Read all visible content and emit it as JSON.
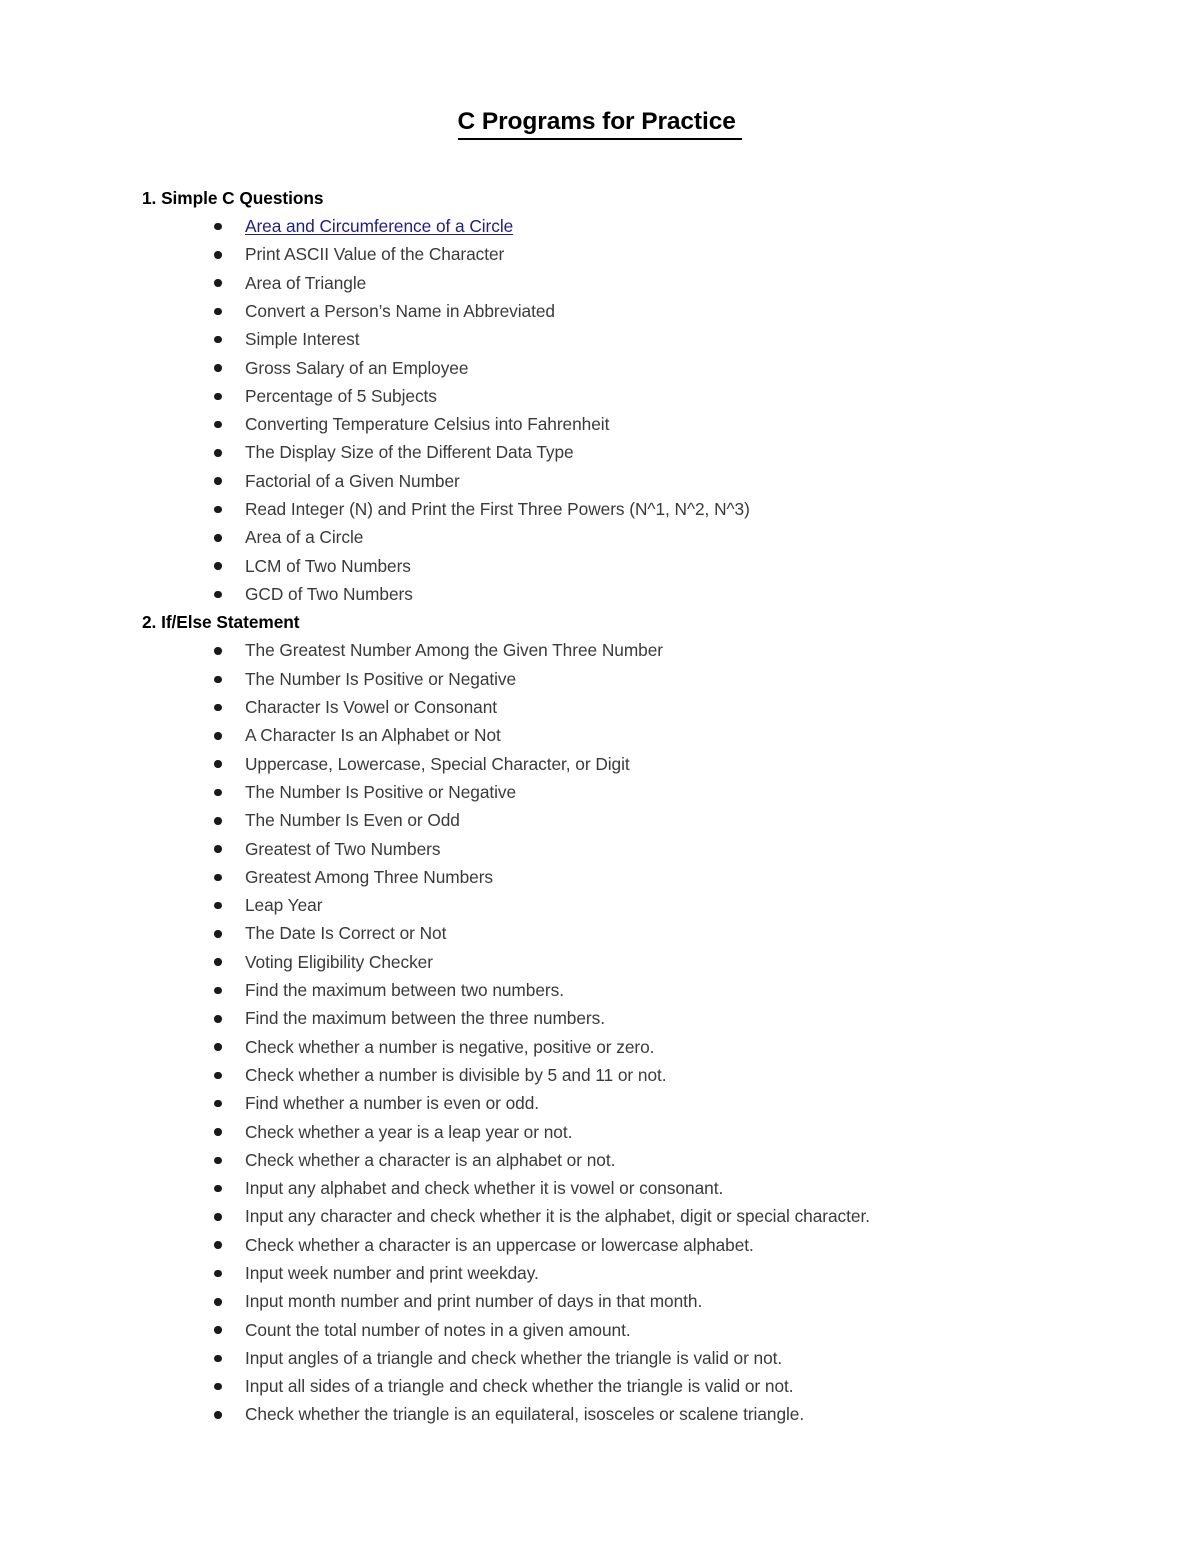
{
  "document": {
    "title": "C Programs for Practice ",
    "link_color": "#1d1d8c",
    "text_color": "#3a3a3a",
    "heading_color": "#000000",
    "background_color": "#ffffff",
    "bullet_glyph": "•"
  },
  "sections": [
    {
      "heading": "1. Simple C Questions",
      "items": [
        {
          "text": "Area and Circumference of a Circle",
          "is_link": true
        },
        {
          "text": "Print ASCII Value of the Character",
          "is_link": false
        },
        {
          "text": "Area of Triangle",
          "is_link": false
        },
        {
          "text": "Convert a Person’s Name in Abbreviated",
          "is_link": false
        },
        {
          "text": "Simple Interest",
          "is_link": false
        },
        {
          "text": "Gross Salary of an Employee",
          "is_link": false
        },
        {
          "text": "Percentage of 5 Subjects",
          "is_link": false
        },
        {
          "text": "Converting Temperature Celsius into Fahrenheit",
          "is_link": false
        },
        {
          "text": "The Display Size of the Different Data Type",
          "is_link": false
        },
        {
          "text": "Factorial of a Given Number",
          "is_link": false
        },
        {
          "text": "Read Integer (N) and Print the First Three Powers (N^1, N^2, N^3)",
          "is_link": false
        },
        {
          "text": "Area of a Circle",
          "is_link": false
        },
        {
          "text": "LCM of Two Numbers",
          "is_link": false
        },
        {
          "text": "GCD of Two Numbers",
          "is_link": false
        }
      ]
    },
    {
      "heading": "2. If/Else Statement",
      "items": [
        {
          "text": "The Greatest Number Among the Given Three Number",
          "is_link": false
        },
        {
          "text": "The Number Is Positive or Negative",
          "is_link": false
        },
        {
          "text": "Character Is Vowel or Consonant",
          "is_link": false
        },
        {
          "text": "A Character Is an Alphabet or Not",
          "is_link": false
        },
        {
          "text": "Uppercase, Lowercase, Special Character, or Digit",
          "is_link": false
        },
        {
          "text": "The Number Is Positive or Negative",
          "is_link": false
        },
        {
          "text": "The Number Is Even or Odd",
          "is_link": false
        },
        {
          "text": "Greatest of Two Numbers",
          "is_link": false
        },
        {
          "text": "Greatest Among Three Numbers",
          "is_link": false
        },
        {
          "text": "Leap Year",
          "is_link": false
        },
        {
          "text": "The Date Is Correct or Not",
          "is_link": false
        },
        {
          "text": "Voting Eligibility Checker",
          "is_link": false
        },
        {
          "text": "Find the maximum between two numbers.",
          "is_link": false
        },
        {
          "text": "Find the maximum between the three numbers.",
          "is_link": false
        },
        {
          "text": "Check whether a number is negative, positive or zero.",
          "is_link": false
        },
        {
          "text": "Check whether a number is divisible by 5 and 11 or not.",
          "is_link": false
        },
        {
          "text": "Find whether a number is even or odd.",
          "is_link": false
        },
        {
          "text": "Check whether a year is a leap year or not.",
          "is_link": false
        },
        {
          "text": "Check whether a character is an alphabet or not.",
          "is_link": false
        },
        {
          "text": "Input any alphabet and check whether it is vowel or consonant.",
          "is_link": false
        },
        {
          "text": "Input any character and check whether it is the alphabet, digit or special character.",
          "is_link": false
        },
        {
          "text": "Check whether a character is an uppercase or lowercase alphabet.",
          "is_link": false
        },
        {
          "text": "Input week number and print weekday.",
          "is_link": false
        },
        {
          "text": "Input month number and print number of days in that month.",
          "is_link": false
        },
        {
          "text": "Count the total number of notes in a given amount.",
          "is_link": false
        },
        {
          "text": "Input angles of a triangle and check whether the triangle is valid or not.",
          "is_link": false
        },
        {
          "text": "Input all sides of a triangle and check whether the triangle is valid or not.",
          "is_link": false
        },
        {
          "text": "Check whether the triangle is an equilateral, isosceles or scalene triangle.",
          "is_link": false
        }
      ]
    }
  ]
}
